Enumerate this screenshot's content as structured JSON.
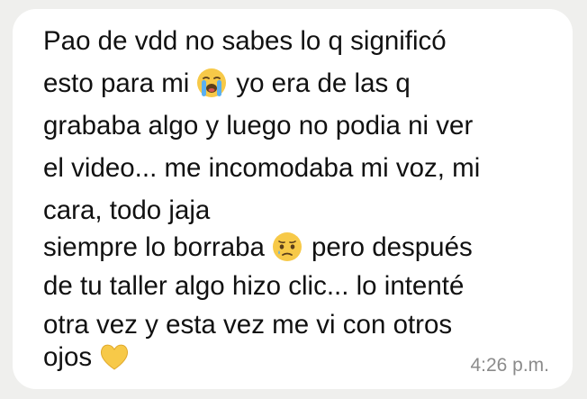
{
  "message": {
    "lines": [
      {
        "text": "Pao de vdd no sabes lo q significó"
      },
      {
        "before": "esto para mi",
        "emoji": "loudly-crying-face-icon",
        "after": "yo era de las q"
      },
      {
        "text": "grababa algo y luego no podia ni ver"
      },
      {
        "text": "el video... me incomodaba mi voz, mi"
      },
      {
        "text": "cara, todo jaja"
      },
      {
        "before": "siempre lo borraba",
        "emoji": "face-holding-back-tears-icon",
        "after": "pero después"
      },
      {
        "text": "de tu taller algo hizo clic... lo intenté"
      },
      {
        "text": "otra vez y esta vez me vi con otros"
      },
      {
        "before": "ojos",
        "emoji": "yellow-heart-icon",
        "after": ""
      }
    ],
    "timestamp": "4:26 p.m."
  },
  "colors": {
    "background": "#efefed",
    "bubble": "#ffffff",
    "text": "#111111",
    "timestamp": "#8b8b8b",
    "emoji_yellow": "#f7c948"
  }
}
